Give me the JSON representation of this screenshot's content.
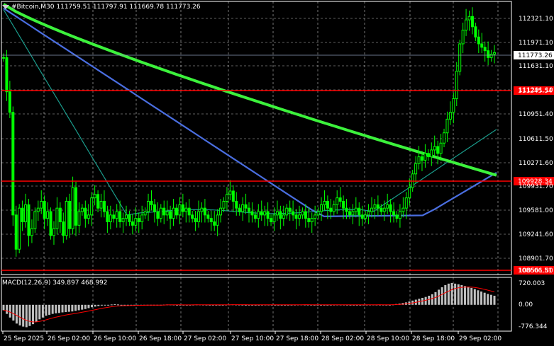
{
  "header": {
    "symbol": "#Bitcoin",
    "timeframe": "M30",
    "ohlc": "111759.51 111797.91 111669.78 111773.26"
  },
  "price_axis": {
    "ticks": [
      "112321.10",
      "111971.10",
      "111631.10",
      "111291.10",
      "110951.40",
      "110611.50",
      "110271.60",
      "109931.70",
      "109581.00",
      "109241.60",
      "108901.70",
      "108561.80"
    ],
    "current_price": "111773.26",
    "levels": [
      {
        "label": "111245.54",
        "color": "#ff0000"
      },
      {
        "label": "109928.34",
        "color": "#ff0000"
      },
      {
        "label": "108606.51",
        "color": "#ff0000"
      }
    ]
  },
  "macd": {
    "label": "MACD(12,26,9) 349.897 468.992",
    "ticks": [
      "720.003",
      "0.00",
      "-776.344"
    ]
  },
  "time_axis": {
    "labels": [
      "25 Sep 2025",
      "26 Sep 02:00",
      "26 Sep 10:00",
      "26 Sep 18:00",
      "27 Sep 02:00",
      "27 Sep 10:00",
      "27 Sep 18:00",
      "28 Sep 02:00",
      "28 Sep 10:00",
      "28 Sep 18:00",
      "29 Sep 02:00"
    ]
  },
  "colors": {
    "background": "#000000",
    "bull": "#00ff00",
    "grid": "#c0c0c0",
    "level_line": "#ff0000",
    "ma_slow": "#3cf23c",
    "ma_mid": "#4a6ee0",
    "ma_fast": "#1a9c8c",
    "macd_hist": "#c0c0c0",
    "macd_signal": "#ff0000",
    "price_line": "#8a9db8"
  },
  "chart_data": {
    "type": "candlestick",
    "ylim": [
      108530,
      112520
    ],
    "macd_ylim": [
      -776.344,
      720.003
    ],
    "close_series": [
      111700,
      111200,
      110900,
      109400,
      108900,
      109500,
      109300,
      109550,
      109100,
      109200,
      109450,
      109500,
      109600,
      109350,
      109450,
      109100,
      109200,
      109500,
      109300,
      109100,
      109600,
      109200,
      109800,
      109250,
      109450,
      109500,
      109350,
      109400,
      109650,
      109700,
      109500,
      109600,
      109450,
      109300,
      109400,
      109350,
      109450,
      109300,
      109350,
      109400,
      109300,
      109250,
      109350,
      109300,
      109400,
      109450,
      109600,
      109550,
      109450,
      109350,
      109500,
      109400,
      109450,
      109350,
      109500,
      109400,
      109550,
      109450,
      109500,
      109400,
      109350,
      109300,
      109450,
      109500,
      109400,
      109350,
      109300,
      109250,
      109400,
      109500,
      109600,
      109700,
      109750,
      109600,
      109500,
      109450,
      109550,
      109500,
      109450,
      109400,
      109350,
      109450,
      109400,
      109450,
      109350,
      109300,
      109400,
      109450,
      109350,
      109400,
      109500,
      109450,
      109400,
      109350,
      109400,
      109450,
      109350,
      109300,
      109350,
      109400,
      109450,
      109550,
      109600,
      109500,
      109450,
      109550,
      109650,
      109600,
      109500,
      109450,
      109400,
      109450,
      109500,
      109400,
      109350,
      109400,
      109450,
      109500,
      109550,
      109500,
      109450,
      109500,
      109550,
      109450,
      109400,
      109350,
      109450,
      109500,
      109650,
      109800,
      110000,
      110150,
      110250,
      110200,
      110300,
      110250,
      110350,
      110400,
      110300,
      110450,
      110600,
      110800,
      110900,
      111100,
      111500,
      111900,
      112100,
      112250,
      112300,
      112150,
      112000,
      111900,
      111850,
      111800,
      111700,
      111750,
      111773
    ],
    "macd_hist": [
      -180,
      -300,
      -420,
      -520,
      -620,
      -680,
      -720,
      -740,
      -700,
      -640,
      -560,
      -480,
      -420,
      -360,
      -330,
      -300,
      -280,
      -270,
      -250,
      -240,
      -230,
      -220,
      -200,
      -180,
      -160,
      -140,
      -110,
      -80,
      -60,
      -40,
      -20,
      -10,
      0,
      10,
      20,
      10,
      0,
      -10,
      -20,
      -15,
      -10,
      -5,
      0,
      -5,
      -10,
      -12,
      -8,
      -4,
      0,
      5,
      10,
      8,
      5,
      0,
      -5,
      -8,
      -5,
      0,
      5,
      10,
      8,
      5,
      3,
      0,
      -3,
      -5,
      -2,
      0,
      5,
      10,
      12,
      8,
      5,
      3,
      0,
      -3,
      -5,
      -3,
      0,
      3,
      5,
      4,
      2,
      0,
      -2,
      -4,
      -2,
      0,
      2,
      4,
      6,
      8,
      6,
      4,
      2,
      0,
      -2,
      -3,
      -2,
      0,
      2,
      4,
      6,
      5,
      4,
      2,
      0,
      -2,
      -1,
      0,
      2,
      4,
      5,
      6,
      5,
      4,
      3,
      2,
      0,
      10,
      25,
      40,
      60,
      80,
      110,
      140,
      170,
      200,
      230,
      260,
      300,
      350,
      420,
      500,
      580,
      650,
      700,
      720,
      700,
      680,
      650,
      620,
      600,
      560,
      520,
      480,
      440,
      400,
      360,
      330,
      300
    ]
  }
}
